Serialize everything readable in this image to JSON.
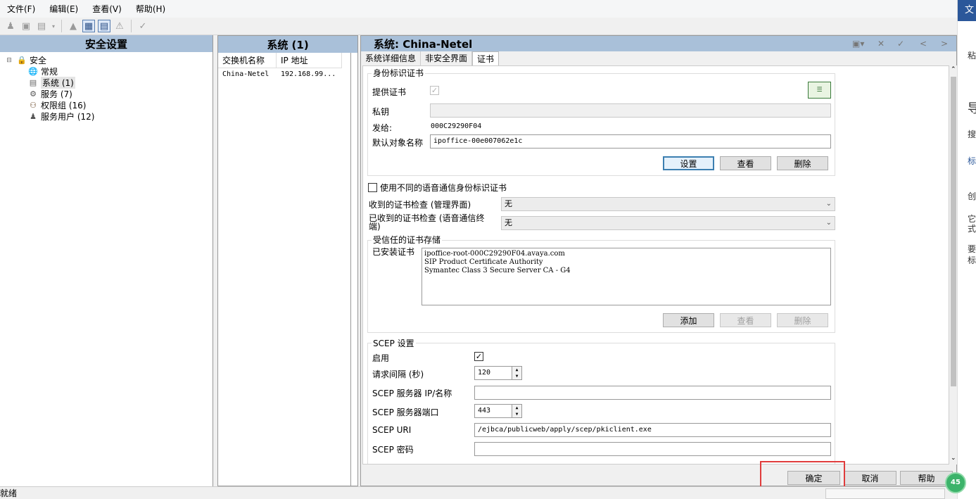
{
  "menu": [
    "文件(F)",
    "编辑(E)",
    "查看(V)",
    "帮助(H)"
  ],
  "left_panel": {
    "title": "安全设置",
    "tree": [
      {
        "label": "安全",
        "icon": "lock-icon"
      },
      {
        "label": "常规",
        "icon": "globe-icon"
      },
      {
        "label": "系统 (1)",
        "icon": "server-icon"
      },
      {
        "label": "服务 (7)",
        "icon": "gear-icon"
      },
      {
        "label": "权限组 (16)",
        "icon": "group-icon"
      },
      {
        "label": "服务用户 (12)",
        "icon": "user-key-icon"
      }
    ]
  },
  "mid_panel": {
    "title": "系统 (1)",
    "columns": [
      "交换机名称",
      "IP 地址"
    ],
    "rows": [
      [
        "China-Netel",
        "192.168.99..."
      ]
    ]
  },
  "right_panel": {
    "title": "系统:  China-Netel",
    "tabs": [
      "系统详细信息",
      "非安全界面",
      "证书"
    ],
    "identity_group": {
      "title": "身份标识证书",
      "provide_cert_label": "提供证书",
      "private_key_label": "私钥",
      "issued_to_label": "发给:",
      "issued_to_value": "000C29290F04",
      "default_subject_label": "默认对象名称",
      "default_subject_value": "ipoffice-00e007062e1c",
      "set_button": "设置",
      "view_button": "查看",
      "delete_button": "删除"
    },
    "use_diff_cert_label": "使用不同的语音通信身份标识证书",
    "received_cert_check_mgmt_label": "收到的证书检查 (管理界面)",
    "received_cert_check_mgmt_value": "无",
    "received_cert_check_voice_label": "已收到的证书检查 (语音通信终端)",
    "received_cert_check_voice_value": "无",
    "trusted_store": {
      "title": "受信任的证书存储",
      "installed_label": "已安装证书",
      "certs": [
        "ipoffice-root-000C29290F04.avaya.com",
        "SIP Product Certificate Authority",
        "Symantec Class 3 Secure Server CA - G4"
      ],
      "add_button": "添加",
      "view_button": "查看",
      "delete_button": "删除"
    },
    "scep": {
      "title": "SCEP 设置",
      "enable_label": "启用",
      "interval_label": "请求间隔 (秒)",
      "interval_value": "120",
      "server_ip_label": "SCEP 服务器 IP/名称",
      "server_ip_value": "",
      "server_port_label": "SCEP 服务器端口",
      "server_port_value": "443",
      "uri_label": "SCEP URI",
      "uri_value": "/ejbca/publicweb/apply/scep/pkiclient.exe",
      "password_label": "SCEP 密码",
      "password_value": ""
    },
    "ok_button": "确定",
    "cancel_button": "取消",
    "help_button": "帮助"
  },
  "status": "就绪",
  "side_strip": {
    "top": "文",
    "items": [
      "粘",
      "导",
      "搜",
      "标",
      "创",
      "它",
      "式",
      "要",
      "标"
    ]
  },
  "badge": "45",
  "colors": {
    "header": "#a9c0d9",
    "highlight": "#e03c3c"
  }
}
